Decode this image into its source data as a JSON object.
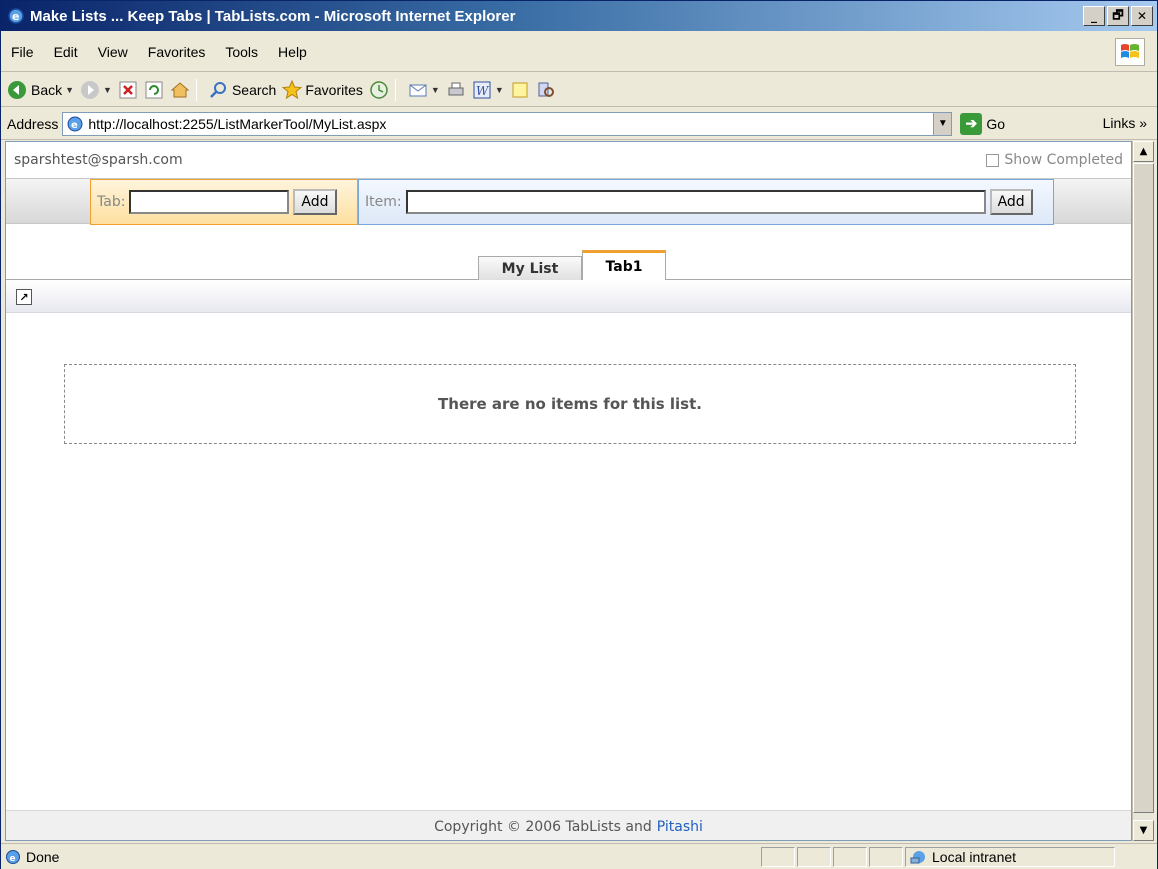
{
  "window": {
    "title": "Make Lists ... Keep Tabs | TabLists.com - Microsoft Internet Explorer",
    "minimize": "_",
    "maximize": "🗗",
    "close": "✕"
  },
  "menu": {
    "items": [
      "File",
      "Edit",
      "View",
      "Favorites",
      "Tools",
      "Help"
    ]
  },
  "toolbar": {
    "back_label": "Back",
    "search_label": "Search",
    "favorites_label": "Favorites"
  },
  "address": {
    "label": "Address",
    "url": "http://localhost:2255/ListMarkerTool/MyList.aspx",
    "go_label": "Go",
    "links_label": "Links »"
  },
  "page": {
    "user_email": "sparshtest@sparsh.com",
    "show_completed_label": "Show Completed",
    "tab_label": "Tab:",
    "tab_value": "",
    "tab_add_label": "Add",
    "item_label": "Item:",
    "item_value": "",
    "item_add_label": "Add",
    "tabs": [
      {
        "label": "My List",
        "active": false
      },
      {
        "label": "Tab1",
        "active": true
      }
    ],
    "empty_message": "There are no items for this list.",
    "footer_text": "Copyright © 2006 TabLists and",
    "footer_link": "Pitashi"
  },
  "status": {
    "text": "Done",
    "zone": "Local intranet"
  },
  "colors": {
    "tab_accent": "#f0a030",
    "item_accent": "#7aa5d8",
    "link": "#2060c0"
  }
}
